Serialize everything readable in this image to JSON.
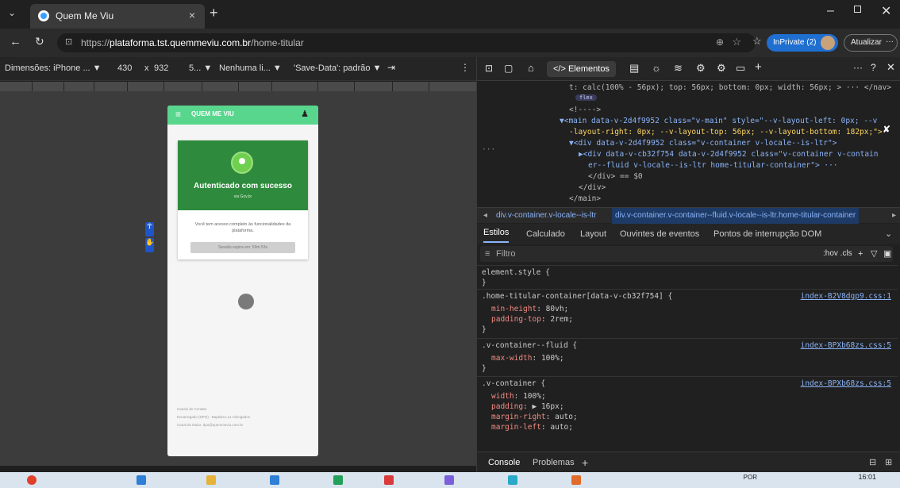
{
  "browser": {
    "tab_title": "Quem Me Viu",
    "tab_close": "×",
    "new_tab": "+",
    "url_prefix": "https://",
    "url_host": "plataforma.tst.quemmeviu.com.br",
    "url_path": "/home-titular",
    "inprivate_label": "InPrivate (2)",
    "update_label": "Atualizar",
    "more": "···"
  },
  "device_toolbar": {
    "dimensions": "Dimensões: iPhone ... ▼",
    "width": "430",
    "times": "x",
    "height": "932",
    "zoom": "5... ▼",
    "throttle": "Nenhuma li... ▼",
    "save_data": "'Save-Data': padrão ▼"
  },
  "app": {
    "brand": "QUEM ME VIU",
    "menu_icon": "≡",
    "profile_icon": "♟",
    "auth_title": "Autenticado com sucesso",
    "auth_via": "via Gov.br",
    "access_text": "Você tem acesso completo às funcionalidades da plataforma.",
    "session_text": "Sessão expira em: 59m 53s",
    "footer_lines": [
      "Canais de Contato",
      "Encarregado (DPO) - Baptista Luz Advogados",
      "Canal do titular: dpo@quemmeviu.com.br"
    ]
  },
  "devtools": {
    "tab_elements": "</> Elementos",
    "dom_lines": [
      "t: calc(100% - 56px); top: 56px; bottom: 0px; width: 56px; > ··· </nav>",
      "flex",
      "<!---->",
      "▼<main data-v-2d4f9952 class=\"v-main\" style=\"--v-layout-left: 0px; --v",
      "-layout-right: 0px; --v-layout-top: 56px; --v-layout-bottom: 182px;\">",
      "▼<div data-v-2d4f9952 class=\"v-container v-locale--is-ltr\">",
      "▶<div data-v-cb32f754 data-v-2d4f9952 class=\"v-container v-contain",
      "er--fluid v-locale--is-ltr home-titular-container\"> ···",
      "</div> == $0",
      "</div>",
      "</main>"
    ],
    "breadcrumb_1": "div.v-container.v-locale--is-ltr",
    "breadcrumb_2": "div.v-container.v-container--fluid.v-locale--is-ltr.home-titular-container",
    "subtabs": [
      "Estilos",
      "Calculado",
      "Layout",
      "Ouvintes de eventos",
      "Pontos de interrupção DOM"
    ],
    "filter_placeholder": "Filtro",
    "filter_tools": ":hov  .cls",
    "rules": [
      {
        "selector": "element.style {",
        "source": "",
        "props": []
      },
      {
        "selector": ".home-titular-container[data-v-cb32f754] {",
        "source": "index-B2V8dgp9.css:1",
        "props": [
          [
            "min-height",
            "80vh;"
          ],
          [
            "padding-top",
            "2rem;"
          ]
        ]
      },
      {
        "selector": ".v-container--fluid {",
        "source": "index-BPXb68zs.css:5",
        "props": [
          [
            "max-width",
            "100%;"
          ]
        ]
      },
      {
        "selector": ".v-container {",
        "source": "index-BPXb68zs.css:5",
        "props": [
          [
            "width",
            "100%;"
          ],
          [
            "padding",
            "▶ 16px;"
          ],
          [
            "margin-right",
            "auto;"
          ],
          [
            "margin-left",
            "auto;"
          ]
        ]
      }
    ],
    "console_tab": "Console",
    "problems_tab": "Problemas",
    "add_tab": "+"
  },
  "taskbar": {
    "lang": "POR",
    "time": "16:01"
  },
  "colors": {
    "app_bar": "#58d68d",
    "auth_card": "#2e8b3d",
    "inprivate": "#1f6fd1"
  }
}
